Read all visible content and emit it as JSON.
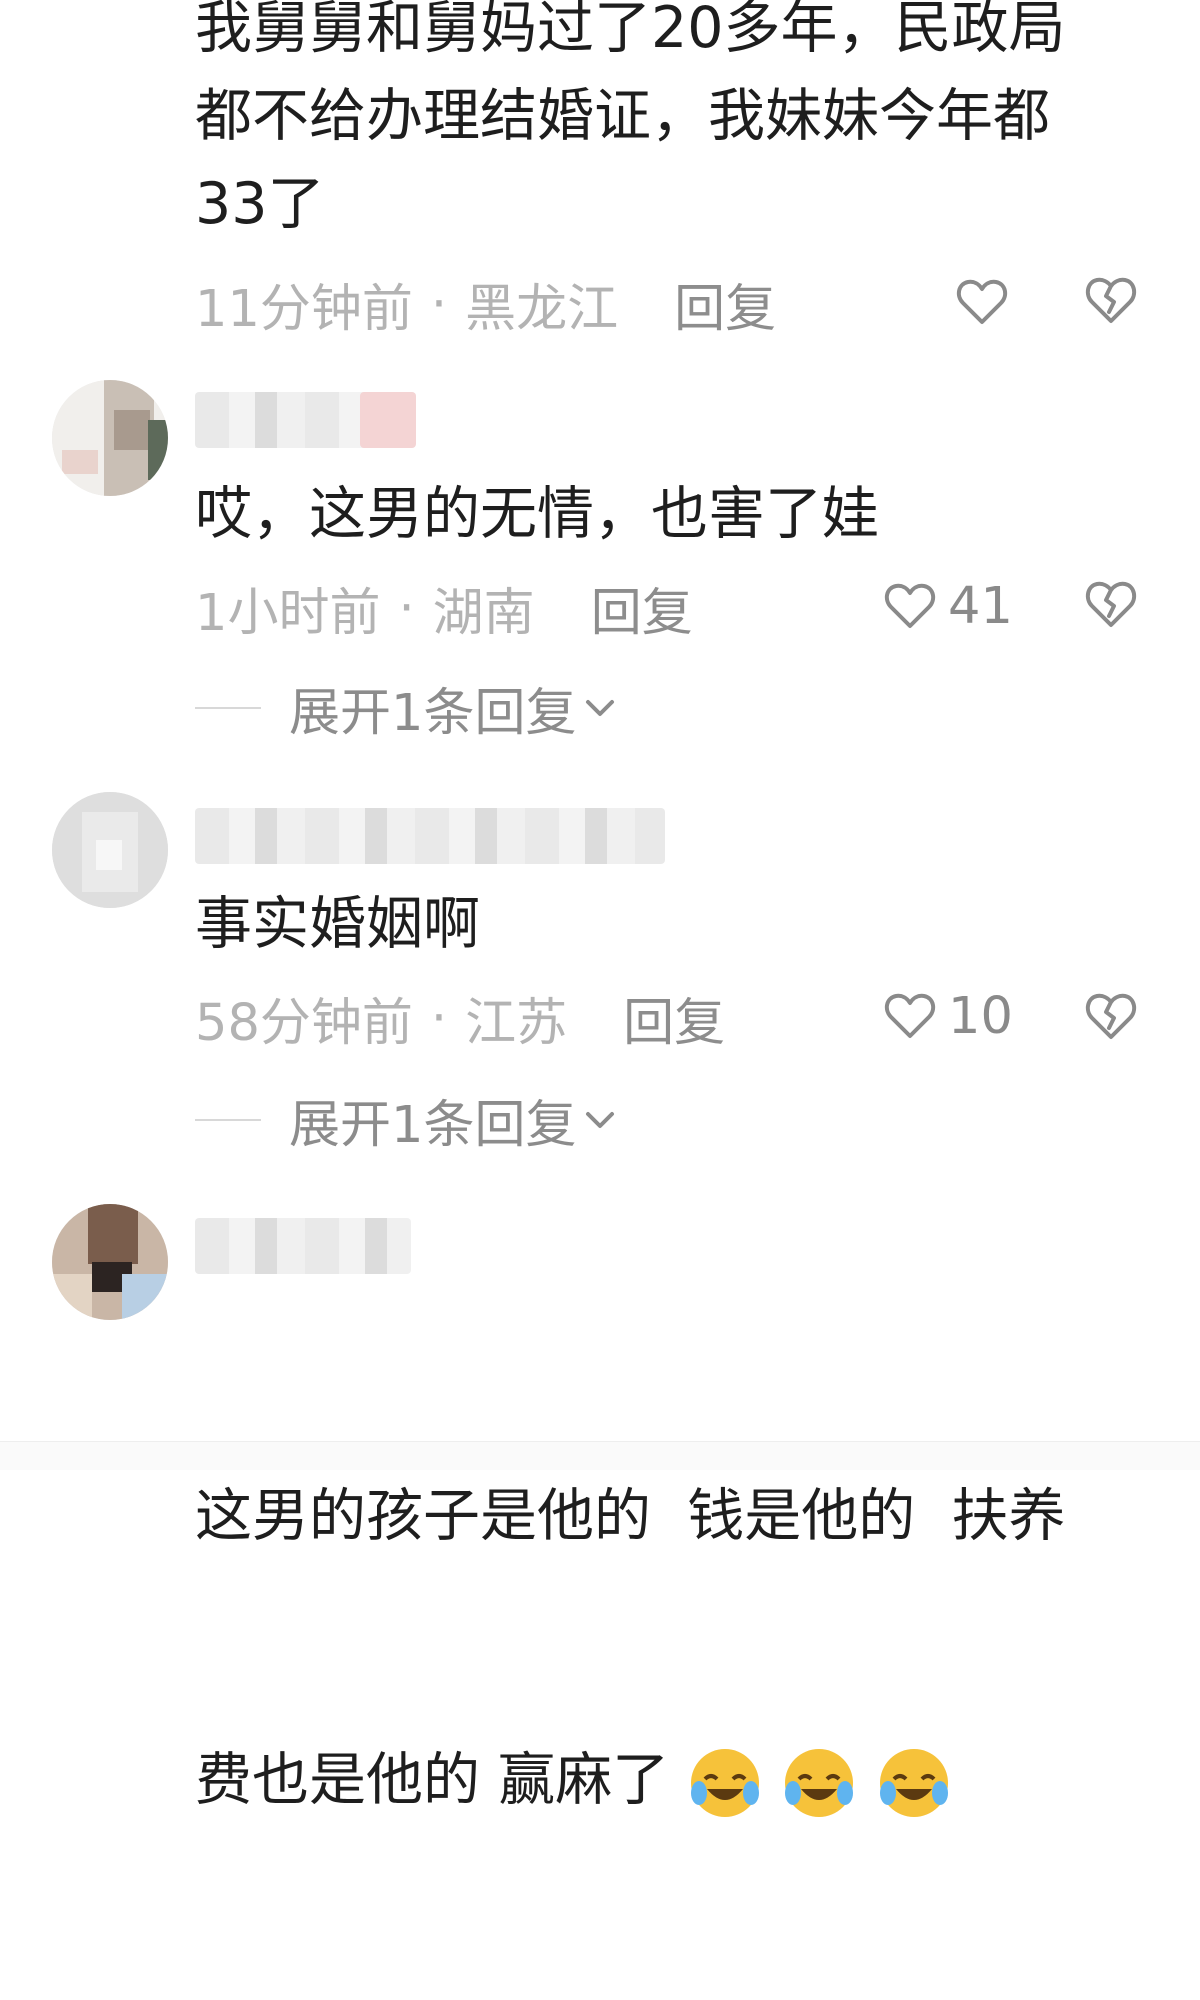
{
  "comments": [
    {
      "text": "我舅舅和舅妈过了20多年，民政局\n都不给办理结婚证，我妹妹今年都\n33了",
      "time": "11分钟前",
      "location": "黑龙江",
      "reply_label": "回复",
      "likes": ""
    },
    {
      "text": "哎，这男的无情，也害了娃",
      "time": "1小时前",
      "location": "湖南",
      "reply_label": "回复",
      "likes": "41",
      "expand_label": "展开1条回复"
    },
    {
      "text": "事实婚姻啊",
      "time": "58分钟前",
      "location": "江苏",
      "reply_label": "回复",
      "likes": "10",
      "expand_label": "展开1条回复"
    },
    {
      "text_line1": "这男的孩子是他的  钱是他的  扶养",
      "text_line2": "费也是他的  赢麻了",
      "emoji": "laughing-crying-emoji"
    }
  ],
  "separator": "·",
  "colors": {
    "meta": "#b3b3b3",
    "text": "#1e1e1e",
    "icon": "#8a8a8a"
  }
}
